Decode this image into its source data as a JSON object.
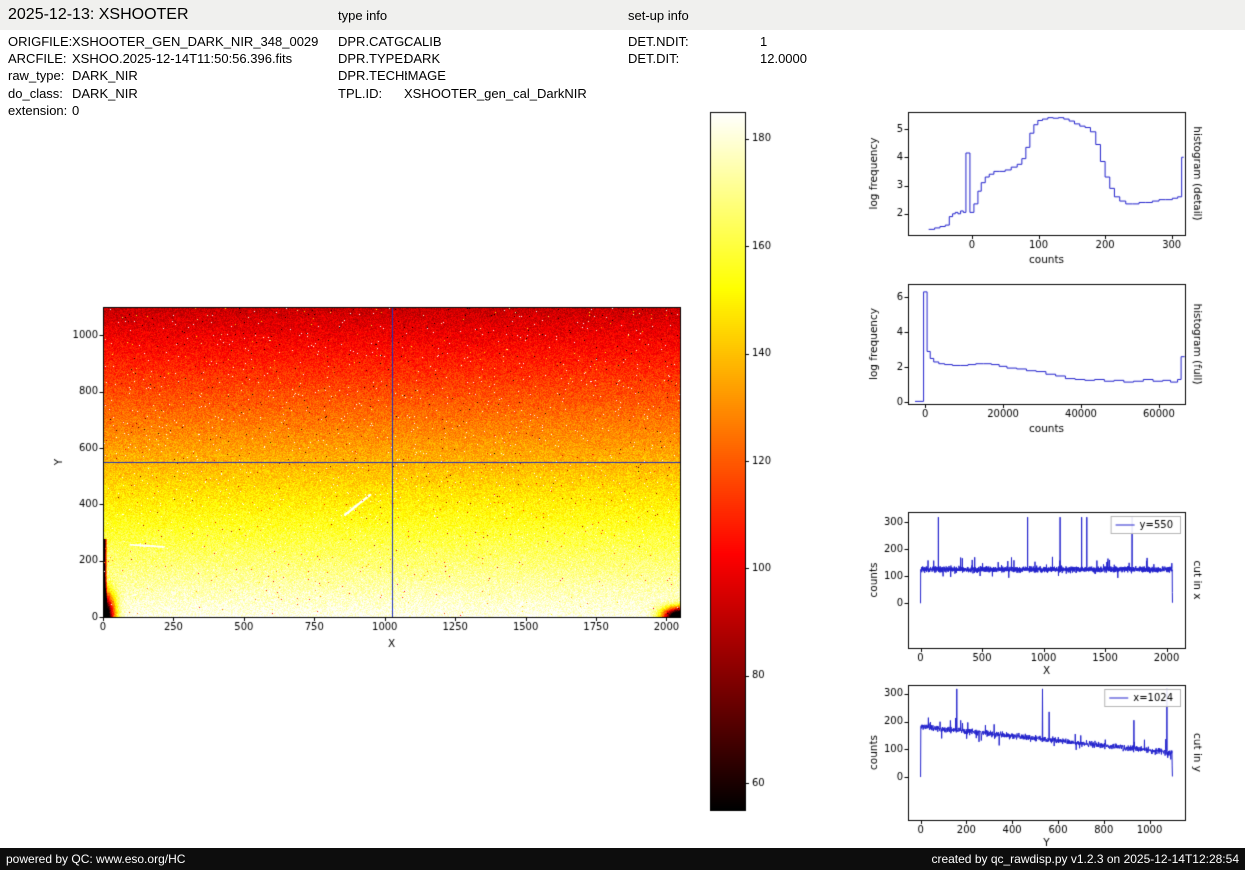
{
  "header": {
    "title": "2025-12-13: XSHOOTER",
    "type_info_label": "type info",
    "setup_info_label": "set-up info"
  },
  "file_info": [
    {
      "label": "ORIGFILE:",
      "value": "XSHOOTER_GEN_DARK_NIR_348_0029"
    },
    {
      "label": "ARCFILE:",
      "value": "XSHOO.2025-12-14T11:50:56.396.fits"
    },
    {
      "label": "raw_type:",
      "value": "DARK_NIR"
    },
    {
      "label": "do_class:",
      "value": "DARK_NIR"
    },
    {
      "label": "extension:",
      "value": "0"
    }
  ],
  "type_info": [
    {
      "label": "DPR.CATG:",
      "value": "CALIB"
    },
    {
      "label": "DPR.TYPE:",
      "value": "DARK"
    },
    {
      "label": "DPR.TECH:",
      "value": "IMAGE"
    },
    {
      "label": "TPL.ID:",
      "value": "XSHOOTER_gen_cal_DarkNIR"
    }
  ],
  "setup_info": [
    {
      "label": "DET.NDIT:",
      "value": "1"
    },
    {
      "label": "DET.DIT:",
      "value": "12.0000"
    }
  ],
  "footer": {
    "left": "powered by QC: www.eso.org/HC",
    "right": "created by qc_rawdisp.py v1.2.3 on 2025-12-14T12:28:54"
  },
  "chart_data": [
    {
      "id": "detector_image",
      "type": "heatmap",
      "xlabel": "X",
      "ylabel": "Y",
      "xlim": [
        0,
        2048
      ],
      "ylim": [
        0,
        1100
      ],
      "xticks": [
        0,
        250,
        500,
        750,
        1000,
        1250,
        1500,
        1750,
        2000
      ],
      "yticks": [
        0,
        200,
        400,
        600,
        800,
        1000
      ],
      "colormap": "hot",
      "vmin": 55,
      "vmax": 185,
      "counts_bottom": 183,
      "counts_top": 92,
      "noise_sd": 7,
      "crosshair_x": 1024,
      "crosshair_y": 550,
      "crosshair_color": "#2233bb",
      "colorbar_ticks": [
        60,
        80,
        100,
        120,
        140,
        160,
        180
      ],
      "artifacts": {
        "left_edge": {
          "width": 14,
          "y_max": 275,
          "depth": 160
        },
        "corner_bl": {
          "sx": 26,
          "sy": 55,
          "depth": 175
        },
        "corner_br": {
          "sx": 40,
          "sy": 22,
          "depth": 175
        },
        "streaks": [
          {
            "x1": 859,
            "y1": 362,
            "x2": 948,
            "y2": 433,
            "w": 6,
            "amp": 60
          },
          {
            "x1": 96,
            "y1": 255,
            "x2": 215,
            "y2": 248,
            "w": 5,
            "amp": 35
          }
        ],
        "hot_pixel_fraction": 0.007
      }
    },
    {
      "id": "histogram_detail",
      "type": "line",
      "style": "step",
      "right_label": "histogram (detail)",
      "xlabel": "counts",
      "ylabel": "log frequency",
      "color": "#2222cc",
      "xlim": [
        -96,
        320
      ],
      "ylim": [
        1.25,
        5.6
      ],
      "xticks": [
        0,
        100,
        200,
        300
      ],
      "yticks": [
        2,
        3,
        4,
        5
      ],
      "x": [
        -65,
        -56,
        -48,
        -40,
        -34,
        -29,
        -25,
        -21,
        -17,
        -13,
        -9,
        -3,
        3,
        9,
        14,
        20,
        26,
        33,
        41,
        50,
        59,
        68,
        75,
        81,
        87,
        93,
        99,
        106,
        114,
        122,
        130,
        138,
        146,
        154,
        162,
        170,
        178,
        186,
        193,
        200,
        207,
        214,
        222,
        231,
        241,
        251,
        261,
        271,
        281,
        291,
        301,
        309,
        315,
        318
      ],
      "y": [
        1.45,
        1.5,
        1.55,
        1.6,
        1.9,
        2.0,
        2.05,
        2.0,
        2.1,
        2.05,
        4.15,
        2.05,
        2.35,
        2.8,
        3.1,
        3.3,
        3.4,
        3.5,
        3.5,
        3.55,
        3.65,
        3.75,
        3.95,
        4.35,
        4.85,
        5.15,
        5.3,
        5.35,
        5.4,
        5.38,
        5.4,
        5.35,
        5.28,
        5.18,
        5.1,
        5.05,
        4.9,
        4.45,
        3.85,
        3.3,
        2.9,
        2.6,
        2.45,
        2.35,
        2.35,
        2.4,
        2.4,
        2.45,
        2.5,
        2.5,
        2.55,
        2.6,
        4.0,
        4.0
      ]
    },
    {
      "id": "histogram_full",
      "type": "line",
      "style": "step",
      "right_label": "histogram (full)",
      "xlabel": "counts",
      "ylabel": "log frequency",
      "color": "#2222cc",
      "xlim": [
        -4400,
        66700
      ],
      "ylim": [
        -0.1,
        6.75
      ],
      "xticks": [
        0,
        20000,
        40000,
        60000
      ],
      "yticks": [
        0,
        2,
        4,
        6
      ],
      "x": [
        -2600,
        -400,
        500,
        1300,
        2200,
        3500,
        5000,
        7000,
        9000,
        11000,
        13000,
        15000,
        17000,
        19000,
        21000,
        23500,
        26000,
        28500,
        31000,
        33500,
        36000,
        38500,
        41000,
        43500,
        46000,
        48500,
        51000,
        53500,
        56000,
        58500,
        61000,
        63000,
        64800,
        65700,
        66600
      ],
      "y": [
        0.05,
        6.3,
        2.9,
        2.5,
        2.3,
        2.2,
        2.15,
        2.1,
        2.1,
        2.15,
        2.2,
        2.2,
        2.15,
        2.05,
        1.95,
        1.9,
        1.8,
        1.75,
        1.6,
        1.5,
        1.35,
        1.3,
        1.25,
        1.3,
        1.2,
        1.25,
        1.15,
        1.2,
        1.3,
        1.2,
        1.25,
        1.15,
        1.3,
        2.6,
        2.6
      ]
    },
    {
      "id": "cut_x",
      "type": "line",
      "legend": "y=550",
      "right_label": "cut in x",
      "xlabel": "X",
      "ylabel": "counts",
      "color": "#2222cc",
      "xlim": [
        -102,
        2150
      ],
      "ylim": [
        -165,
        337
      ],
      "xticks": [
        0,
        500,
        1000,
        1500,
        2000
      ],
      "yticks": [
        0,
        100,
        200,
        300
      ],
      "gen": {
        "n": 2048,
        "xmax": 2048,
        "baseline": 125,
        "noise_sd": 6,
        "seed": 7,
        "spikes": [
          {
            "x": 145,
            "v": 318
          },
          {
            "x": 440,
            "v": 170
          },
          {
            "x": 870,
            "v": 318
          },
          {
            "x": 1135,
            "v": 318
          },
          {
            "x": 1310,
            "v": 318
          },
          {
            "x": 1352,
            "v": 318
          },
          {
            "x": 1524,
            "v": 165
          },
          {
            "x": 1720,
            "v": 318
          }
        ],
        "edge_zero": true
      }
    },
    {
      "id": "cut_y",
      "type": "line",
      "legend": "x=1024",
      "right_label": "cut in y",
      "xlabel": "Y",
      "ylabel": "counts",
      "color": "#2222cc",
      "xlim": [
        -55,
        1155
      ],
      "ylim": [
        -155,
        332
      ],
      "xticks": [
        0,
        200,
        400,
        600,
        800,
        1000
      ],
      "yticks": [
        0,
        100,
        200,
        300
      ],
      "gen": {
        "n": 1100,
        "xmax": 1100,
        "trend": [
          183,
          88
        ],
        "noise_sd": 6,
        "seed": 11,
        "spikes": [
          {
            "x": 158,
            "v": 318
          },
          {
            "x": 532,
            "v": 318
          },
          {
            "x": 562,
            "v": 235
          },
          {
            "x": 700,
            "v": 150
          },
          {
            "x": 932,
            "v": 205
          },
          {
            "x": 1076,
            "v": 318
          }
        ],
        "edge_zero": true
      }
    }
  ]
}
